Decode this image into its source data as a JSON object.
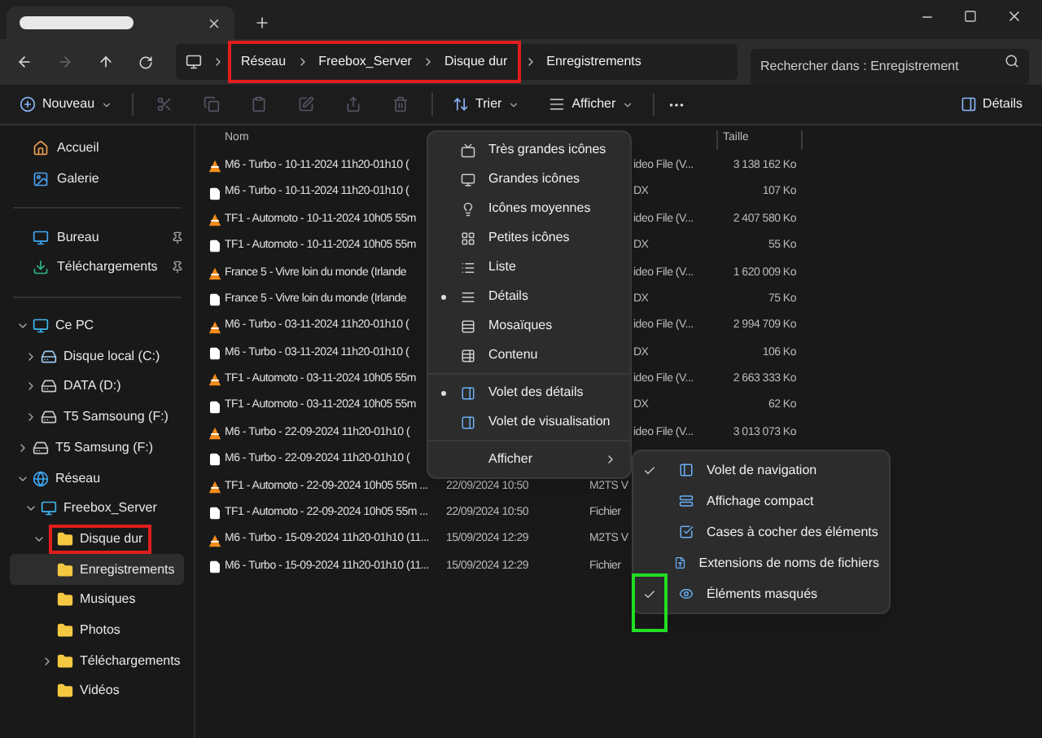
{
  "address_bar": {
    "breadcrumbs": [
      {
        "label": "Réseau",
        "highlighted": true
      },
      {
        "label": "Freebox_Server",
        "highlighted": true
      },
      {
        "label": "Disque dur",
        "highlighted": true
      },
      {
        "label": "Enregistrements",
        "highlighted": false
      }
    ],
    "search": {
      "placeholder": "Rechercher dans : Enregistrement"
    }
  },
  "toolbar": {
    "new": "Nouveau",
    "sort": "Trier",
    "view": "Afficher",
    "details": "Détails"
  },
  "sidebar": {
    "sections": [
      {
        "items": [
          {
            "label": "Accueil",
            "kind": "home",
            "pinned": false
          },
          {
            "label": "Galerie",
            "kind": "gallery",
            "pinned": false
          }
        ]
      },
      {
        "items": [
          {
            "label": "Bureau",
            "kind": "desktop",
            "pinned": true
          },
          {
            "label": "Téléchargements",
            "kind": "download",
            "pinned": true
          }
        ]
      }
    ],
    "tree": [
      {
        "label": "Ce PC",
        "kind": "pc",
        "expanded": true,
        "children": [
          {
            "label": "Disque local (C:)",
            "kind": "system-drive",
            "expanded": false
          },
          {
            "label": "DATA (D:)",
            "kind": "drive",
            "expanded": false
          },
          {
            "label": "T5 Samsoung (F:)",
            "kind": "drive",
            "expanded": false
          }
        ]
      },
      {
        "label": "T5 Samsung (F:)",
        "kind": "drive",
        "expanded": false
      },
      {
        "label": "Réseau",
        "kind": "network",
        "expanded": true,
        "children": [
          {
            "label": "Freebox_Server",
            "kind": "pc",
            "expanded": true,
            "children": [
              {
                "label": "Disque dur",
                "kind": "folder",
                "expanded": true,
                "highlighted": true,
                "children": [
                  {
                    "label": "Enregistrements",
                    "kind": "folder",
                    "selected": true
                  },
                  {
                    "label": "Musiques",
                    "kind": "folder",
                    "selected": false
                  },
                  {
                    "label": "Photos",
                    "kind": "folder",
                    "selected": false
                  },
                  {
                    "label": "Téléchargements",
                    "kind": "folder",
                    "expanded": false,
                    "selected": false
                  },
                  {
                    "label": "Vidéos",
                    "kind": "folder",
                    "selected": false
                  }
                ]
              }
            ]
          }
        ]
      }
    ]
  },
  "file_list": {
    "columns": [
      "Nom",
      "Taille"
    ],
    "rows": [
      {
        "kind": "video",
        "name": "M6 - Turbo - 10-11-2024 11h20-01h10 (",
        "type": "ideo File (V...",
        "size": "3 138 162 Ko"
      },
      {
        "kind": "file",
        "name": "M6 - Turbo - 10-11-2024 11h20-01h10 (",
        "type": "DX",
        "size": "107 Ko"
      },
      {
        "kind": "video",
        "name": "TF1 - Automoto - 10-11-2024 10h05 55m",
        "type": "ideo File (V...",
        "size": "2 407 580 Ko"
      },
      {
        "kind": "file",
        "name": "TF1 - Automoto - 10-11-2024 10h05 55m",
        "type": "DX",
        "size": "55 Ko"
      },
      {
        "kind": "video",
        "name": "France 5 - Vivre loin du monde (Irlande",
        "type": "ideo File (V...",
        "size": "1 620 009 Ko"
      },
      {
        "kind": "file",
        "name": "France 5 - Vivre loin du monde (Irlande",
        "type": "DX",
        "size": "75 Ko"
      },
      {
        "kind": "video",
        "name": "M6 - Turbo - 03-11-2024 11h20-01h10 (",
        "type": "ideo File (V...",
        "size": "2 994 709 Ko"
      },
      {
        "kind": "file",
        "name": "M6 - Turbo - 03-11-2024 11h20-01h10 (",
        "type": "DX",
        "size": "106 Ko"
      },
      {
        "kind": "video",
        "name": "TF1 - Automoto - 03-11-2024 10h05 55m",
        "type": "ideo File (V...",
        "size": "2 663 333 Ko"
      },
      {
        "kind": "file",
        "name": "TF1 - Automoto - 03-11-2024 10h05 55m",
        "type": "DX",
        "size": "62 Ko"
      },
      {
        "kind": "video",
        "name": "M6 - Turbo - 22-09-2024 11h20-01h10 (",
        "type": "ideo File (V...",
        "size": "3 013 073 Ko"
      },
      {
        "kind": "file",
        "name": "M6 - Turbo - 22-09-2024 11h20-01h10 ("
      },
      {
        "kind": "video",
        "name": "TF1 - Automoto - 22-09-2024 10h05 55m ...",
        "date": "22/09/2024 10:50",
        "type": "M2TS V"
      },
      {
        "kind": "file",
        "name": "TF1 - Automoto - 22-09-2024 10h05 55m ...",
        "date": "22/09/2024 10:50",
        "type": "Fichier"
      },
      {
        "kind": "video",
        "name": "M6 - Turbo - 15-09-2024 11h20-01h10 (11...",
        "date": "15/09/2024 12:29",
        "type": "M2TS V"
      },
      {
        "kind": "file",
        "name": "M6 - Turbo - 15-09-2024 11h20-01h10 (11...",
        "date": "15/09/2024 12:29",
        "type": "Fichier"
      }
    ]
  },
  "view_menu": {
    "layouts": [
      {
        "label": "Très grandes icônes",
        "selected": false
      },
      {
        "label": "Grandes icônes",
        "selected": false
      },
      {
        "label": "Icônes moyennes",
        "selected": false
      },
      {
        "label": "Petites icônes",
        "selected": false
      },
      {
        "label": "Liste",
        "selected": false
      },
      {
        "label": "Détails",
        "selected": true
      },
      {
        "label": "Mosaïques",
        "selected": false
      },
      {
        "label": "Contenu",
        "selected": false
      }
    ],
    "panes": [
      {
        "label": "Volet des détails",
        "checked": true
      },
      {
        "label": "Volet de visualisation",
        "checked": false
      }
    ],
    "submenu": "Afficher"
  },
  "show_submenu": {
    "items": [
      {
        "label": "Volet de navigation",
        "checked": true
      },
      {
        "label": "Affichage compact",
        "checked": false
      },
      {
        "label": "Cases à cocher des éléments",
        "checked": false
      },
      {
        "label": "Extensions de noms de fichiers",
        "checked": false
      },
      {
        "label": "Éléments masqués",
        "checked": true,
        "highlighted": true
      }
    ]
  }
}
